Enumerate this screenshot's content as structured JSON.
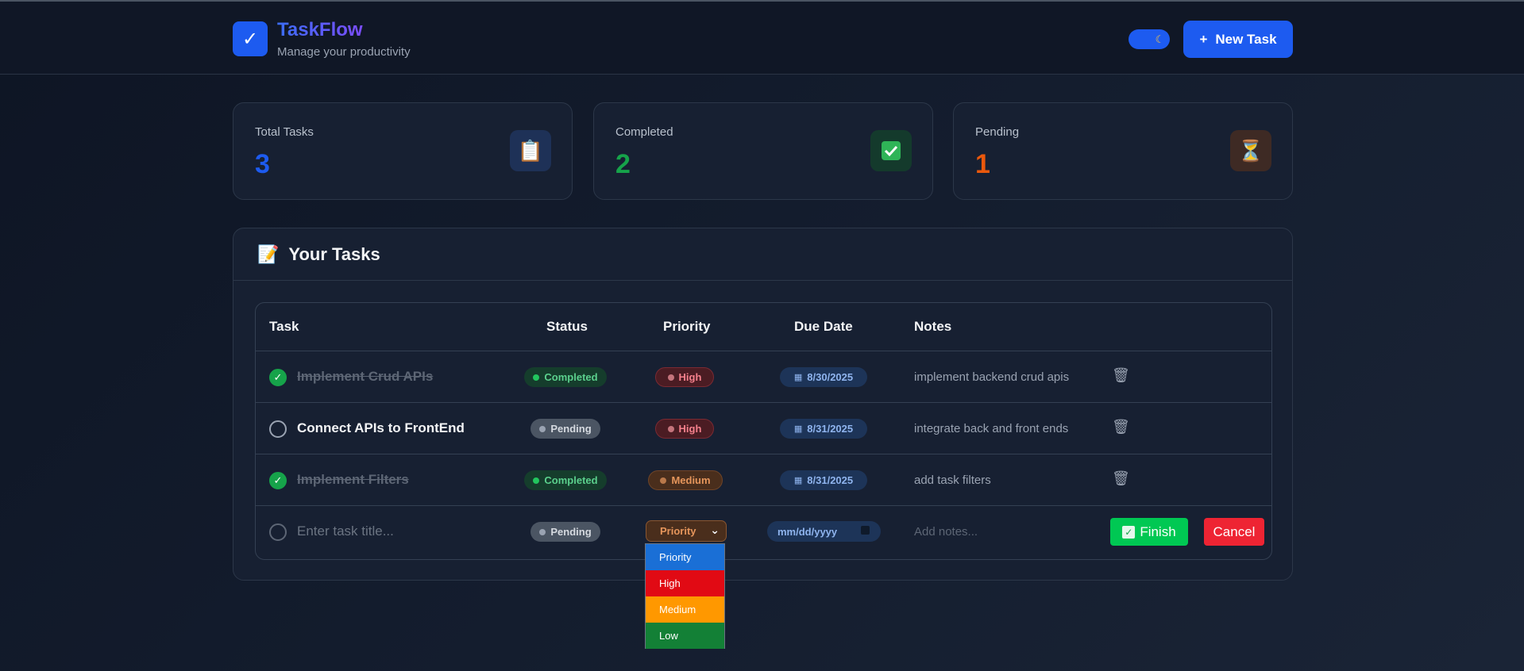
{
  "header": {
    "app_title": "TaskFlow",
    "app_subtitle": "Manage your productivity",
    "logo_glyph": "✓",
    "theme_icon": "moon-icon",
    "new_task_label": "New Task",
    "new_task_glyph": "+"
  },
  "stats": [
    {
      "label": "Total Tasks",
      "value": "3",
      "icon": "clipboard-icon",
      "color": "#1d5bf0",
      "icon_bg": "#1e3157"
    },
    {
      "label": "Completed",
      "value": "2",
      "icon": "check-box-icon",
      "color": "#16a34a",
      "icon_bg": "#143a2c"
    },
    {
      "label": "Pending",
      "value": "1",
      "icon": "hourglass-icon",
      "color": "#ea580c",
      "icon_bg": "#3e2a24"
    }
  ],
  "tasks_panel": {
    "title": "Your Tasks",
    "columns": [
      "Task",
      "Status",
      "Priority",
      "Due Date",
      "Notes"
    ]
  },
  "tasks": [
    {
      "title": "Implement Crud APIs",
      "done": true,
      "status": "Completed",
      "priority": "High",
      "due": "8/30/2025",
      "notes": "implement backend crud apis"
    },
    {
      "title": "Connect APIs to FrontEnd",
      "done": false,
      "status": "Pending",
      "priority": "High",
      "due": "8/31/2025",
      "notes": "integrate back and front ends"
    },
    {
      "title": "Implement Filters",
      "done": true,
      "status": "Completed",
      "priority": "Medium",
      "due": "8/31/2025",
      "notes": "add task filters"
    }
  ],
  "new_task_row": {
    "title_placeholder": "Enter task title...",
    "status": "Pending",
    "priority_selected": "Priority",
    "date_placeholder": "mm/dd/yyyy",
    "notes_placeholder": "Add notes...",
    "finish_label": "Finish",
    "cancel_label": "Cancel"
  },
  "priority_options": [
    {
      "label": "Priority",
      "color": "#1a6fd6"
    },
    {
      "label": "High",
      "color": "#e10a14"
    },
    {
      "label": "Medium",
      "color": "#ff9800"
    },
    {
      "label": "Low",
      "color": "#138036"
    }
  ],
  "colors": {
    "accent": "#1d5bf0",
    "finish": "#00c853",
    "cancel": "#ee2433"
  }
}
